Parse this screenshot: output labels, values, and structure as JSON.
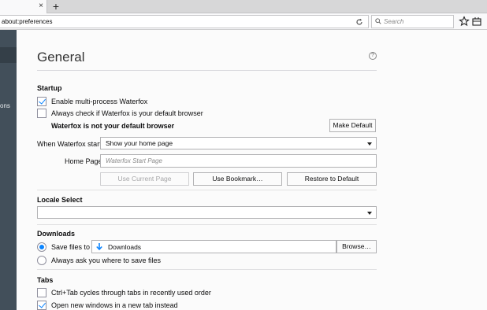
{
  "browser": {
    "tab_close": "×",
    "new_tab": "+",
    "url": "about:preferences",
    "search_placeholder": "Search"
  },
  "sidebar": {
    "fragment": "ons"
  },
  "page": {
    "title": "General",
    "help": "?"
  },
  "startup": {
    "heading": "Startup",
    "multiprocess": {
      "label": "Enable multi-process Waterfox",
      "checked": true
    },
    "default_check": {
      "label": "Always check if Waterfox is your default browser",
      "checked": false
    },
    "default_status": "Waterfox is not your default browser",
    "make_default_label": "Make Default",
    "starts_label": "When Waterfox starts:",
    "starts_value": "Show your home page",
    "homepage_label": "Home Page:",
    "homepage_placeholder": "Waterfox Start Page",
    "use_current_label": "Use Current Page",
    "use_bookmark_label": "Use Bookmark…",
    "restore_default_label": "Restore to Default"
  },
  "locale": {
    "heading": "Locale Select",
    "value": ""
  },
  "downloads": {
    "heading": "Downloads",
    "save_to_label": "Save files to",
    "save_to_selected": true,
    "folder": "Downloads",
    "browse_label": "Browse…",
    "ask_label": "Always ask you where to save files",
    "ask_selected": false
  },
  "tabs": {
    "heading": "Tabs",
    "ctrl_tab": {
      "label": "Ctrl+Tab cycles through tabs in recently used order",
      "checked": false
    },
    "new_windows": {
      "label": "Open new windows in a new tab instead",
      "checked": true
    }
  },
  "colors": {
    "accent": "#0a84ff",
    "sidebar": "#424f5a"
  }
}
